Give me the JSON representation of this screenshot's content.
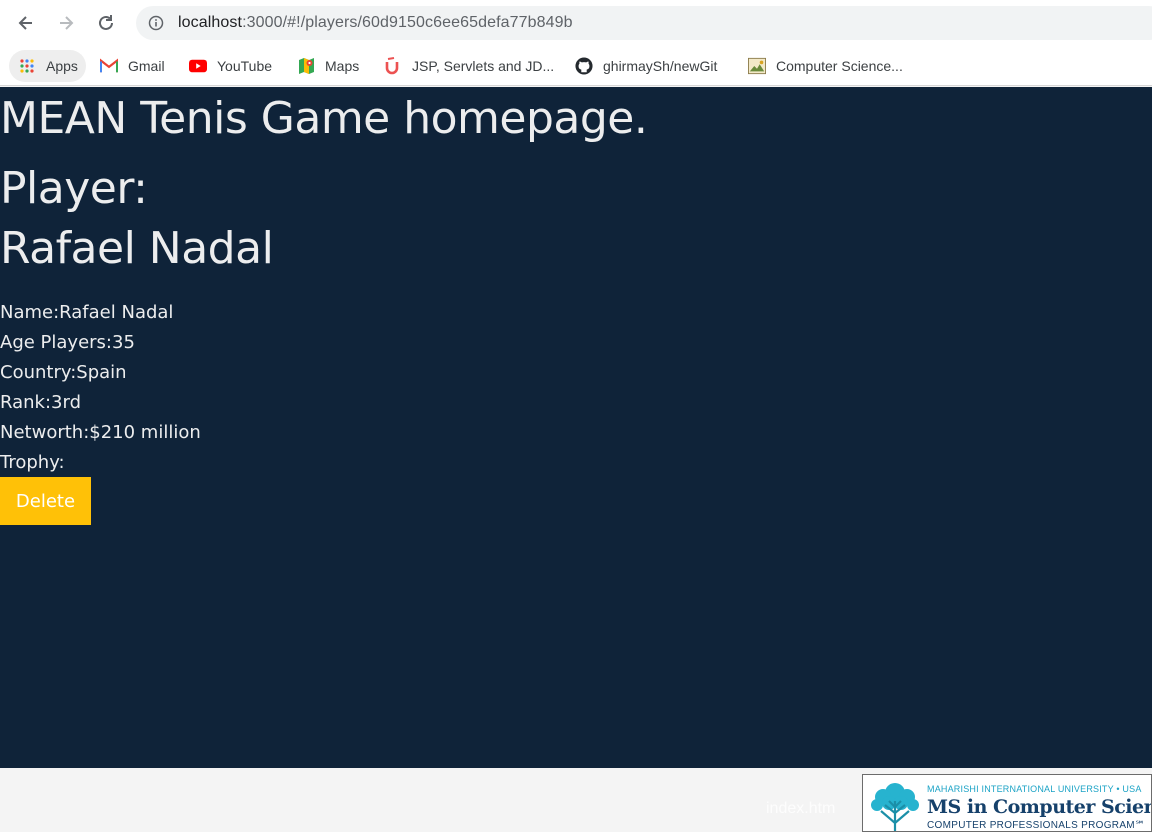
{
  "browser": {
    "url_host": "localhost",
    "url_path": ":3000/#!/players/60d9150c6ee65defa77b849b",
    "bookmarks": [
      {
        "label": "Apps",
        "icon": "apps-grid-icon"
      },
      {
        "label": "Gmail",
        "icon": "gmail-icon"
      },
      {
        "label": "YouTube",
        "icon": "youtube-icon"
      },
      {
        "label": "Maps",
        "icon": "maps-icon"
      },
      {
        "label": "JSP, Servlets and JD...",
        "icon": "udemy-icon"
      },
      {
        "label": "ghirmaySh/newGit",
        "icon": "github-icon"
      },
      {
        "label": "Computer Science...",
        "icon": "bookmark-image-icon"
      }
    ]
  },
  "page": {
    "title": "MEAN Tenis Game homepage.",
    "player_heading": "Player:",
    "player_name_heading": "Rafael Nadal",
    "details": {
      "name": "Name:Rafael Nadal",
      "age": "Age Players:35",
      "country": "Country:Spain",
      "rank": "Rank:3rd",
      "networth": "Networth:$210 million",
      "trophy": "Trophy:"
    },
    "delete_label": "Delete"
  },
  "footer": {
    "file_label": "index.htm"
  },
  "banner": {
    "line1": "MAHARISHI INTERNATIONAL UNIVERSITY • USA",
    "line2": "MS in Computer Science",
    "line3": "COMPUTER PROFESSIONALS PROGRAM℠"
  },
  "colors": {
    "page_background": "#0f2339",
    "page_text": "#ecedee",
    "delete_button": "#ffc107"
  }
}
